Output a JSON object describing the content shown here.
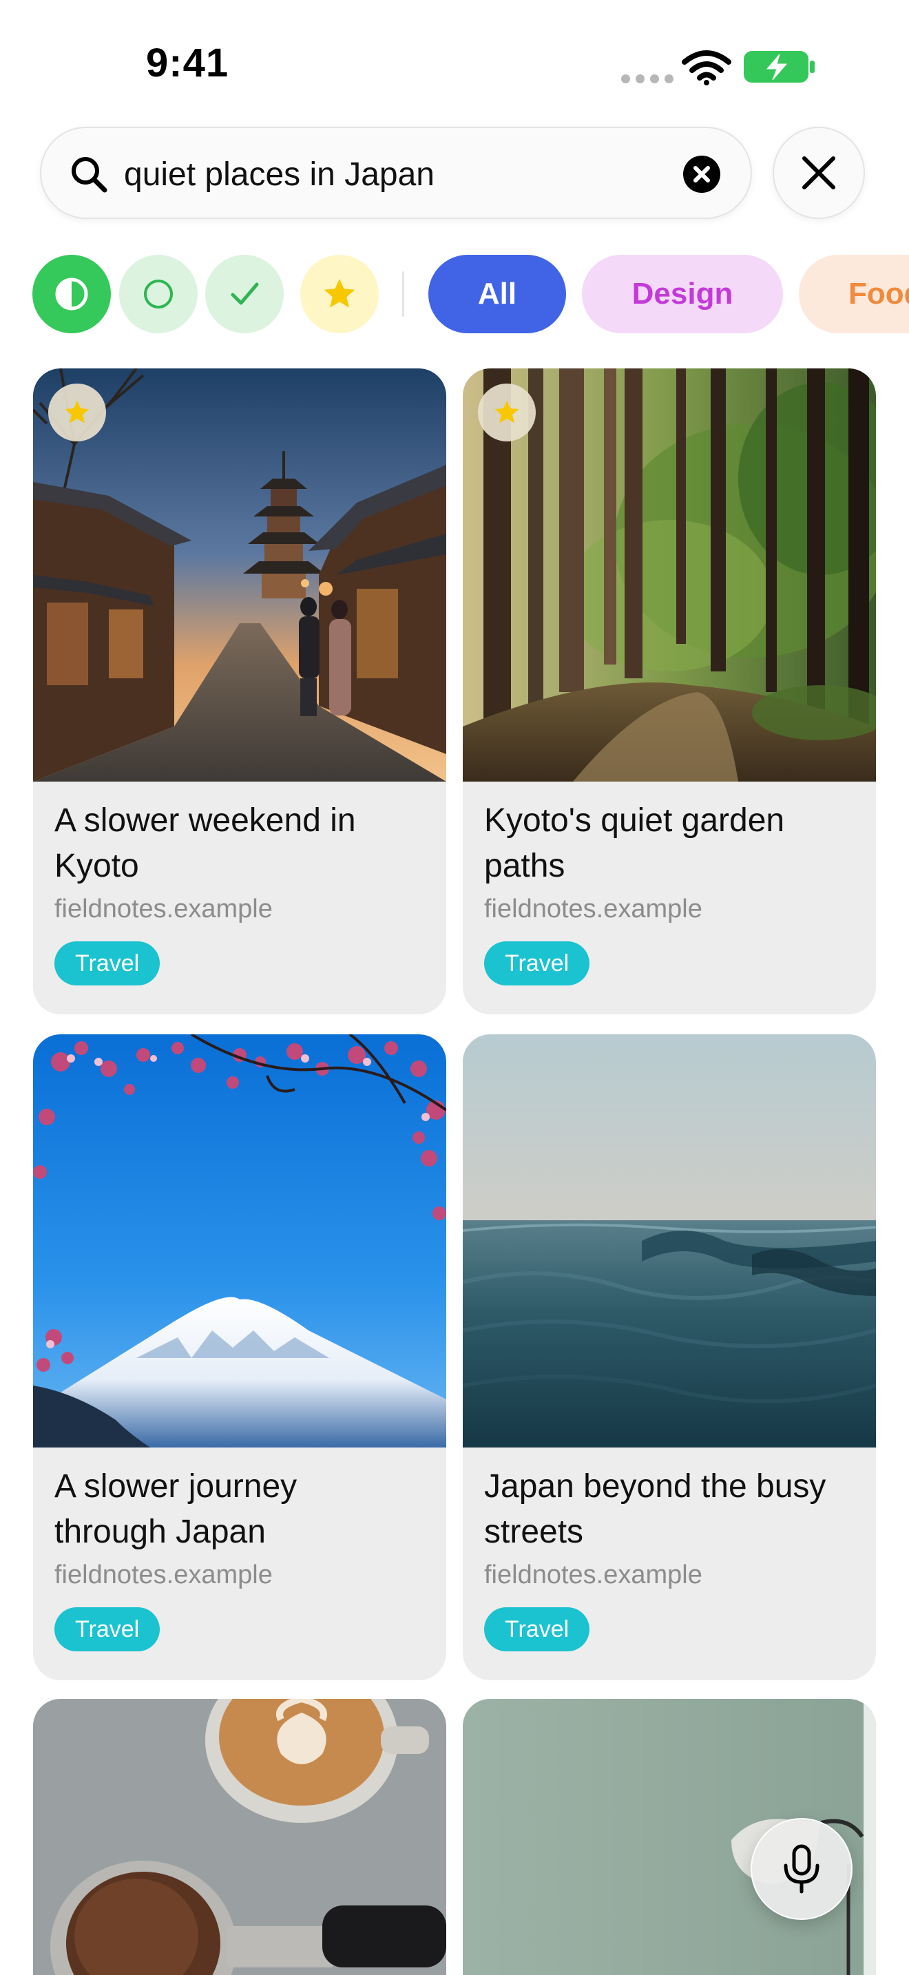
{
  "status_bar": {
    "time": "9:41"
  },
  "search": {
    "query": "quiet places in Japan"
  },
  "filters": {
    "status_icons": [
      "half-circle-icon",
      "circle-outline-icon",
      "checkmark-icon",
      "star-icon"
    ],
    "chips": [
      {
        "label": "All",
        "selected": true,
        "color": "#4164e6"
      },
      {
        "label": "Design",
        "selected": false,
        "color": "#c43ad9"
      },
      {
        "label": "Food",
        "selected": false,
        "color": "#f08a3c"
      }
    ]
  },
  "cards": [
    {
      "title": "A slower weekend in Kyoto",
      "source": "fieldnotes.example",
      "tag": "Travel",
      "favorite": true,
      "image": "kyoto-pagoda-street"
    },
    {
      "title": "Kyoto's quiet garden paths",
      "source": "fieldnotes.example",
      "tag": "Travel",
      "favorite": true,
      "image": "forest-path"
    },
    {
      "title": "A slower journey through Japan",
      "source": "fieldnotes.example",
      "tag": "Travel",
      "favorite": false,
      "image": "mount-fuji-blossoms"
    },
    {
      "title": "Japan beyond the busy streets",
      "source": "fieldnotes.example",
      "tag": "Travel",
      "favorite": false,
      "image": "ocean-waves"
    },
    {
      "title": "",
      "source": "",
      "tag": "",
      "favorite": false,
      "image": "coffee-espresso"
    },
    {
      "title": "",
      "source": "",
      "tag": "",
      "favorite": false,
      "image": "green-wall-lamp"
    }
  ],
  "colors": {
    "accent": "#4164e6",
    "tag": "#1bc2d0",
    "success": "#35c85a",
    "star": "#f7c700"
  }
}
